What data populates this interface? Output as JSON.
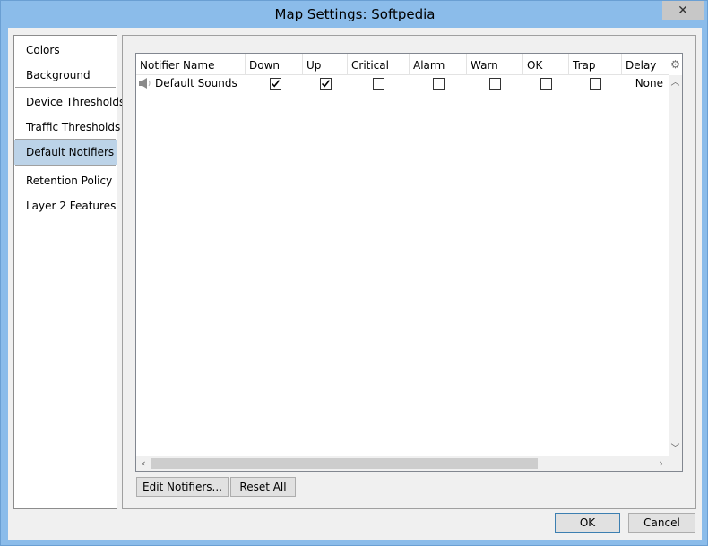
{
  "window": {
    "title": "Map Settings: Softpedia",
    "close_glyph": "✕"
  },
  "nav": {
    "items": [
      {
        "label": "Colors"
      },
      {
        "label": "Background"
      },
      {
        "label": "Device Thresholds"
      },
      {
        "label": "Traffic Thresholds"
      },
      {
        "label": "Default Notifiers"
      },
      {
        "label": "Retention Policy"
      },
      {
        "label": "Layer 2 Features"
      }
    ],
    "selected": "Default Notifiers"
  },
  "grid": {
    "columns": [
      "Notifier Name",
      "Down",
      "Up",
      "Critical",
      "Alarm",
      "Warn",
      "OK",
      "Trap",
      "Delay"
    ],
    "rows": [
      {
        "name": "Default Sounds",
        "icon": "speaker-icon",
        "down": true,
        "up": true,
        "critical": false,
        "alarm": false,
        "warn": false,
        "ok": false,
        "trap": false,
        "delay": "None"
      }
    ],
    "settings_icon": "gear-icon"
  },
  "buttons": {
    "edit_notifiers": "Edit Notifiers...",
    "reset_all": "Reset All",
    "ok": "OK",
    "cancel": "Cancel"
  },
  "colors": {
    "titlebar": "#8bbcea",
    "selection": "#bcd3e8",
    "default_button_border": "#3c7fb1"
  }
}
